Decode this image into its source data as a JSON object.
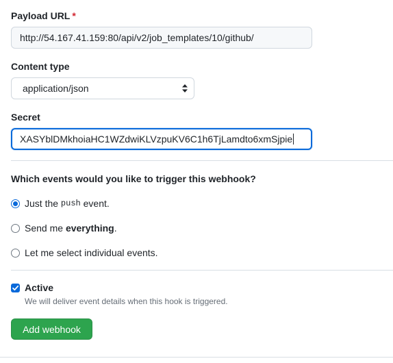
{
  "payload": {
    "label": "Payload URL",
    "required_mark": "*",
    "value": "http://54.167.41.159:80/api/v2/job_templates/10/github/"
  },
  "content_type": {
    "label": "Content type",
    "selected": "application/json"
  },
  "secret": {
    "label": "Secret",
    "value": "XASYblDMkhoiaHC1WZdwiKLVzpuKV6C1h6TjLamdto6xmSjpie"
  },
  "events": {
    "heading": "Which events would you like to trigger this webhook?",
    "options": [
      {
        "prefix": "Just the ",
        "code": "push",
        "suffix": " event.",
        "checked": true
      },
      {
        "prefix": "Send me ",
        "strong": "everything",
        "suffix": ".",
        "checked": false
      },
      {
        "text": "Let me select individual events.",
        "checked": false
      }
    ]
  },
  "active": {
    "label": "Active",
    "checked": true,
    "note": "We will deliver event details when this hook is triggered."
  },
  "submit": {
    "label": "Add webhook"
  },
  "colors": {
    "accent": "#0969da",
    "primary_button": "#2da44e",
    "required": "#d1242f"
  },
  "icons": {
    "select_arrows": "up-down-arrows-icon",
    "checkbox_check": "check-icon"
  }
}
